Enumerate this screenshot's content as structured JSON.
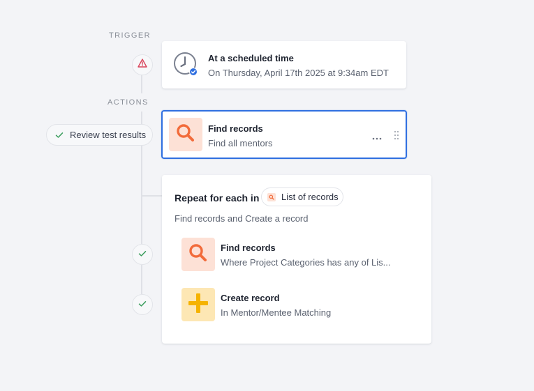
{
  "sections": {
    "trigger_label": "TRIGGER",
    "actions_label": "ACTIONS"
  },
  "trigger": {
    "title": "At a scheduled time",
    "subtitle": "On Thursday, April 17th 2025 at 9:34am EDT",
    "status_icon": "warning-triangle-icon",
    "app_icon": "clock-icon"
  },
  "review_pill": {
    "label": "Review test results",
    "icon": "check-icon"
  },
  "find_records_action": {
    "title": "Find records",
    "subtitle": "Find all mentors",
    "icon": "search-icon",
    "menu_icon": "more-horizontal-icon",
    "drag_icon": "drag-handle-icon"
  },
  "repeat_block": {
    "title": "Repeat for each in",
    "chip_label": "List of records",
    "description": "Find records and Create a record",
    "steps": [
      {
        "title": "Find records",
        "subtitle": "Where Project Categories has any of Lis...",
        "icon": "search-icon",
        "status_icon": "check-icon"
      },
      {
        "title": "Create record",
        "subtitle": "In Mentor/Mentee Matching",
        "icon": "plus-icon",
        "status_icon": "check-icon"
      }
    ]
  },
  "colors": {
    "accent_blue": "#2f6fe0",
    "search_orange": "#f26b3a",
    "plus_yellow": "#f5b301",
    "warning_red": "#d9435a",
    "success_green": "#3a9d5d"
  }
}
